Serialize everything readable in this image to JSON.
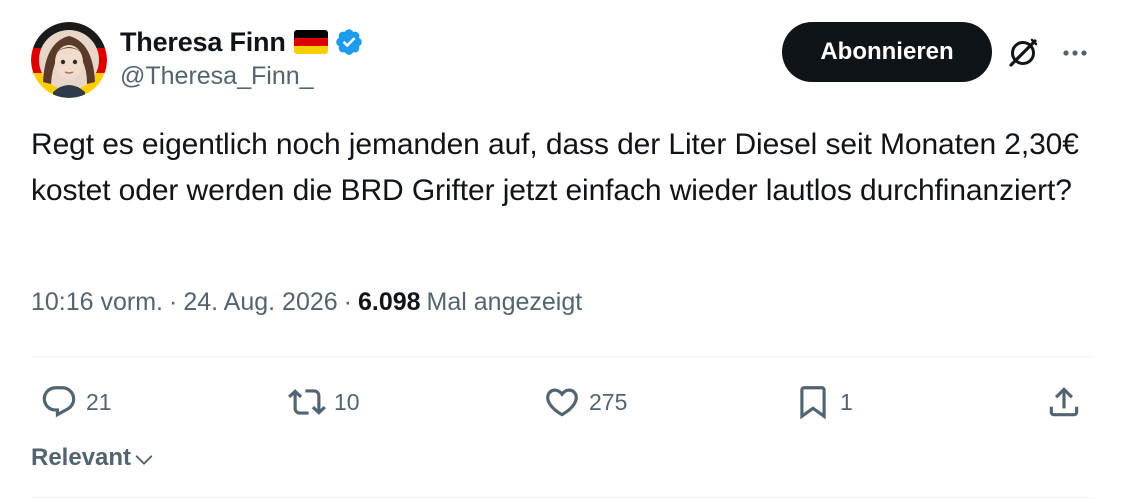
{
  "author": {
    "display_name": "Theresa Finn",
    "handle": "@Theresa_Finn_",
    "flag": "germany-flag",
    "verified": true
  },
  "header": {
    "follow_label": "Abonnieren",
    "grok_icon": "grok-icon",
    "more_icon": "more-icon"
  },
  "tweet": {
    "text": "Regt es eigentlich noch jemanden auf, dass der Liter Diesel seit Monaten 2,30€ kostet oder werden die BRD Grifter jetzt einfach wieder lautlos durchfinanziert?",
    "time": "10:16 vorm.",
    "separator": "·",
    "date": "24. Aug. 2026",
    "views_count": "6.098",
    "views_label": "Mal angezeigt"
  },
  "actions": {
    "replies": "21",
    "reposts": "10",
    "likes": "275",
    "bookmarks": "1"
  },
  "sort": {
    "label": "Relevant"
  },
  "colors": {
    "text": "#0f1419",
    "secondary": "#536471",
    "verified": "#1d9bf0",
    "button_bg": "#0f1419",
    "divider": "#eff3f4"
  }
}
